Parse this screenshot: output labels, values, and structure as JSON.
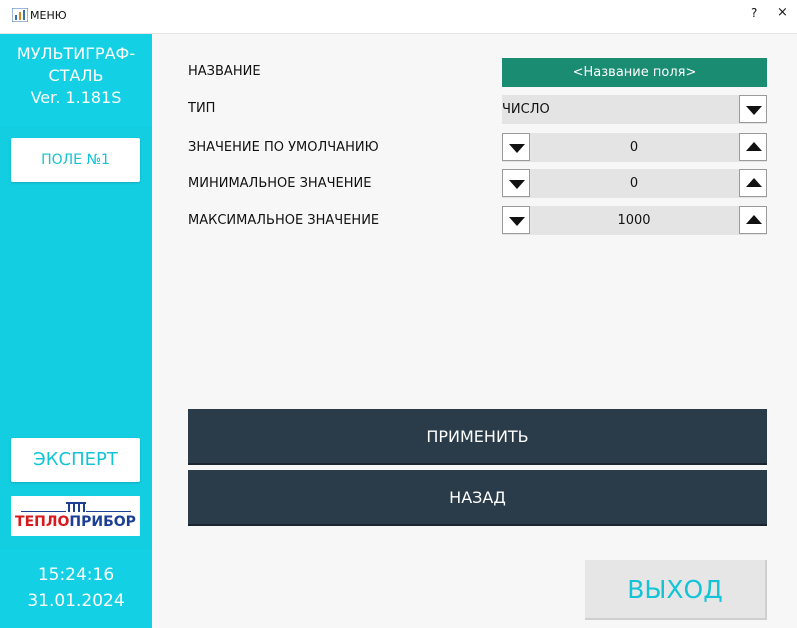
{
  "window": {
    "title": "МЕНЮ",
    "help": "?",
    "close": "×"
  },
  "sidebar": {
    "app_name_line1": "МУЛЬТИГРАФ-",
    "app_name_line2": "СТАЛЬ",
    "version": "Ver. 1.181S",
    "field_card": "ПОЛЕ №1",
    "expert_label": "ЭКСПЕРТ",
    "logo_part1": "ТЕПЛО",
    "logo_part2": "ПРИБОР",
    "time": "15:24:16",
    "date": "31.01.2024"
  },
  "form": {
    "name_label": "НАЗВАНИЕ",
    "name_value": "<Название поля>",
    "type_label": "ТИП",
    "type_value": "ЧИСЛО",
    "default_label": "ЗНАЧЕНИЕ ПО УМОЛЧАНИЮ",
    "default_value": "0",
    "min_label": "МИНИМАЛЬНОЕ ЗНАЧЕНИЕ",
    "min_value": "0",
    "max_label": "МАКСИМАЛЬНОЕ ЗНАЧЕНИЕ",
    "max_value": "1000"
  },
  "actions": {
    "apply": "ПРИМЕНИТЬ",
    "back": "НАЗАД",
    "exit": "ВЫХОД"
  },
  "icons": {
    "app": "chart-icon",
    "down": "triangle-down-icon",
    "up": "triangle-up-icon"
  },
  "colors": {
    "sidebar": "#13cde0",
    "name_field": "#1a8c72",
    "dark_button": "#2a3b4a",
    "accent_text": "#13c3d6"
  }
}
